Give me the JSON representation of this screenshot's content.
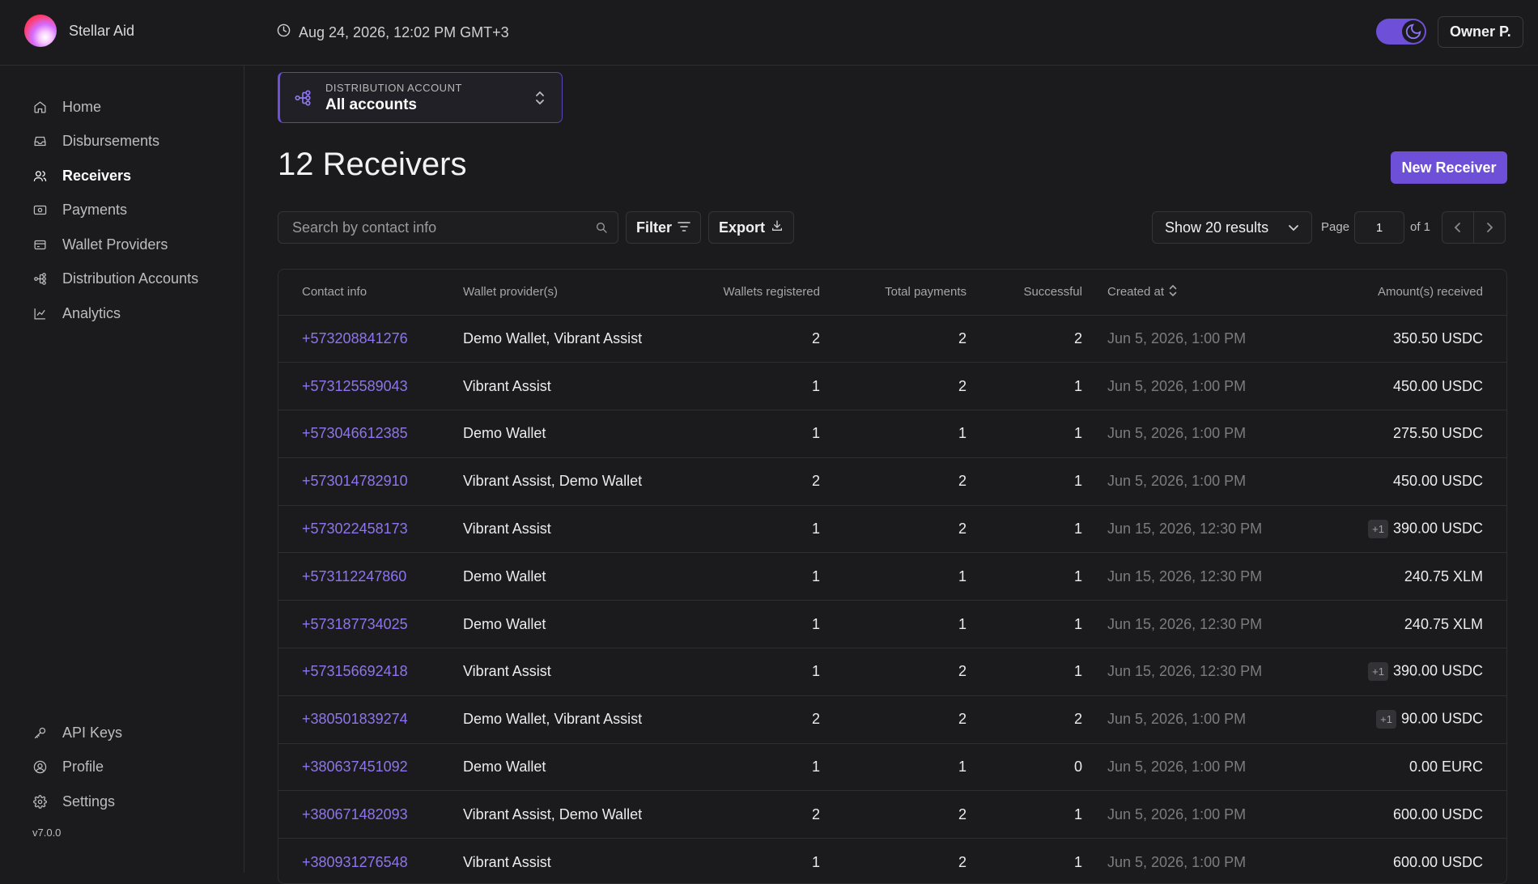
{
  "header": {
    "brand_name": "Stellar Aid",
    "datetime": "Aug 24, 2026, 12:02 PM GMT+3",
    "user_label": "Owner P.",
    "theme": "dark"
  },
  "sidebar": {
    "items": [
      {
        "label": "Home",
        "icon": "home-icon"
      },
      {
        "label": "Disbursements",
        "icon": "inbox-icon"
      },
      {
        "label": "Receivers",
        "icon": "users-icon",
        "active": true
      },
      {
        "label": "Payments",
        "icon": "payment-icon"
      },
      {
        "label": "Wallet Providers",
        "icon": "wallet-icon"
      },
      {
        "label": "Distribution Accounts",
        "icon": "distribution-icon"
      },
      {
        "label": "Analytics",
        "icon": "chart-line-icon"
      }
    ],
    "bottom_items": [
      {
        "label": "API Keys",
        "icon": "key-icon"
      },
      {
        "label": "Profile",
        "icon": "profile-icon"
      },
      {
        "label": "Settings",
        "icon": "gear-icon"
      }
    ],
    "version": "v7.0.0"
  },
  "distribution_account": {
    "label": "DISTRIBUTION ACCOUNT",
    "value": "All accounts"
  },
  "page": {
    "title": "12 Receivers",
    "new_button": "New Receiver"
  },
  "toolbar": {
    "search_placeholder": "Search by contact info",
    "filter_label": "Filter",
    "export_label": "Export",
    "results_select": "Show 20 results",
    "page_label": "Page",
    "page_value": "1",
    "of_label": "of 1"
  },
  "table": {
    "columns": [
      "Contact info",
      "Wallet provider(s)",
      "Wallets registered",
      "Total payments",
      "Successful",
      "Created at",
      "Amount(s) received"
    ],
    "rows": [
      {
        "contact": "+573208841276",
        "providers": "Demo Wallet, Vibrant Assist",
        "registered": "2",
        "total": "2",
        "successful": "2",
        "created": "Jun 5, 2026, 1:00 PM",
        "extra": "",
        "amount": "350.50 USDC"
      },
      {
        "contact": "+573125589043",
        "providers": "Vibrant Assist",
        "registered": "1",
        "total": "2",
        "successful": "1",
        "created": "Jun 5, 2026, 1:00 PM",
        "extra": "",
        "amount": "450.00 USDC"
      },
      {
        "contact": "+573046612385",
        "providers": "Demo Wallet",
        "registered": "1",
        "total": "1",
        "successful": "1",
        "created": "Jun 5, 2026, 1:00 PM",
        "extra": "",
        "amount": "275.50 USDC"
      },
      {
        "contact": "+573014782910",
        "providers": "Vibrant Assist, Demo Wallet",
        "registered": "2",
        "total": "2",
        "successful": "1",
        "created": "Jun 5, 2026, 1:00 PM",
        "extra": "",
        "amount": "450.00 USDC"
      },
      {
        "contact": "+573022458173",
        "providers": "Vibrant Assist",
        "registered": "1",
        "total": "2",
        "successful": "1",
        "created": "Jun 15, 2026, 12:30 PM",
        "extra": "+1",
        "amount": "390.00 USDC"
      },
      {
        "contact": "+573112247860",
        "providers": "Demo Wallet",
        "registered": "1",
        "total": "1",
        "successful": "1",
        "created": "Jun 15, 2026, 12:30 PM",
        "extra": "",
        "amount": "240.75 XLM"
      },
      {
        "contact": "+573187734025",
        "providers": "Demo Wallet",
        "registered": "1",
        "total": "1",
        "successful": "1",
        "created": "Jun 15, 2026, 12:30 PM",
        "extra": "",
        "amount": "240.75 XLM"
      },
      {
        "contact": "+573156692418",
        "providers": "Vibrant Assist",
        "registered": "1",
        "total": "2",
        "successful": "1",
        "created": "Jun 15, 2026, 12:30 PM",
        "extra": "+1",
        "amount": "390.00 USDC"
      },
      {
        "contact": "+380501839274",
        "providers": "Demo Wallet, Vibrant Assist",
        "registered": "2",
        "total": "2",
        "successful": "2",
        "created": "Jun 5, 2026, 1:00 PM",
        "extra": "+1",
        "amount": "90.00 USDC"
      },
      {
        "contact": "+380637451092",
        "providers": "Demo Wallet",
        "registered": "1",
        "total": "1",
        "successful": "0",
        "created": "Jun 5, 2026, 1:00 PM",
        "extra": "",
        "amount": "0.00 EURC"
      },
      {
        "contact": "+380671482093",
        "providers": "Vibrant Assist, Demo Wallet",
        "registered": "2",
        "total": "2",
        "successful": "1",
        "created": "Jun 5, 2026, 1:00 PM",
        "extra": "",
        "amount": "600.00 USDC"
      },
      {
        "contact": "+380931276548",
        "providers": "Vibrant Assist",
        "registered": "1",
        "total": "2",
        "successful": "1",
        "created": "Jun 5, 2026, 1:00 PM",
        "extra": "",
        "amount": "600.00 USDC"
      }
    ]
  },
  "colors": {
    "accent": "#6e4fd8",
    "link": "#8e74f0",
    "background": "#1b1b1d"
  }
}
